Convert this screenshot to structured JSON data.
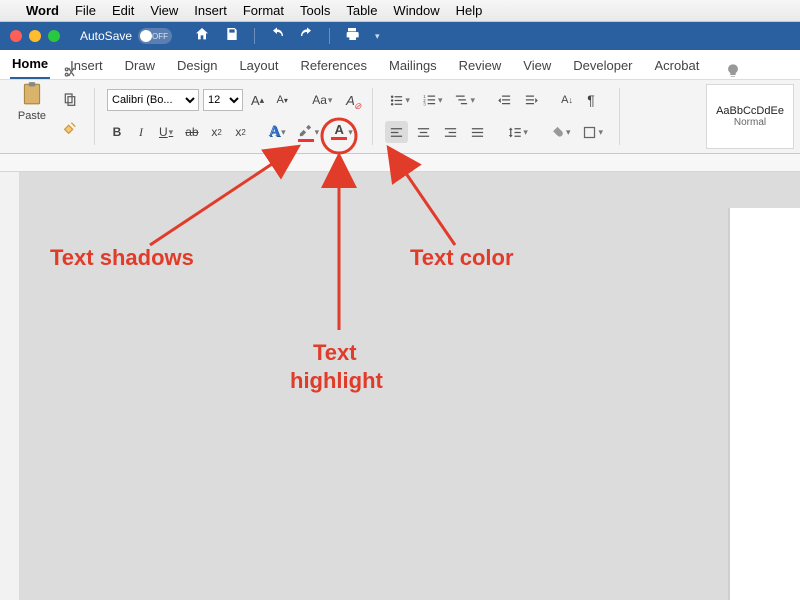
{
  "menubar": {
    "app": "Word",
    "items": [
      "File",
      "Edit",
      "View",
      "Insert",
      "Format",
      "Tools",
      "Table",
      "Window",
      "Help"
    ]
  },
  "titlebar": {
    "autosave_label": "AutoSave",
    "autosave_off": "OFF"
  },
  "tabs": {
    "items": [
      "Home",
      "Insert",
      "Draw",
      "Design",
      "Layout",
      "References",
      "Mailings",
      "Review",
      "View",
      "Developer",
      "Acrobat"
    ],
    "active": "Home"
  },
  "ribbon": {
    "paste_label": "Paste",
    "font_name": "Calibri (Bo...",
    "font_size": "12",
    "styles_sample": "AaBbCcDdEe",
    "styles_name": "Normal"
  },
  "annotations": {
    "shadow": "Text shadows",
    "highlight1": "Text",
    "highlight2": "highlight",
    "color": "Text color"
  }
}
